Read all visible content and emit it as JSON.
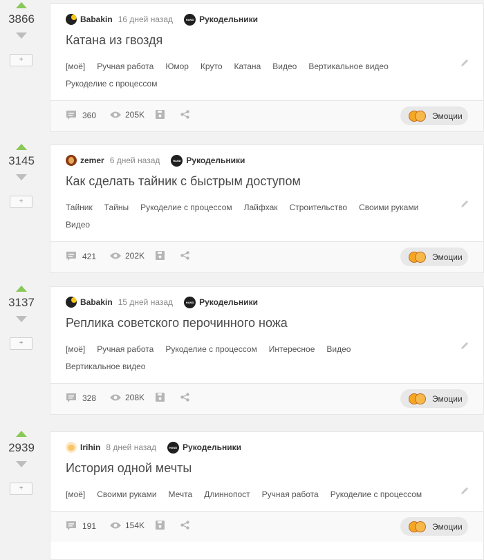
{
  "posts": [
    {
      "score": "3866",
      "plus_label": "+",
      "author": "Babakin",
      "time": "16 дней назад",
      "community": "Рукодельники",
      "community_logo_text": "HAND MADE",
      "title": "Катана из гвоздя",
      "tags": [
        "[моё]",
        "Ручная работа",
        "Юмор",
        "Круто",
        "Катана",
        "Видео",
        "Вертикальное видео",
        "Рукоделие с процессом"
      ],
      "comments": "360",
      "views": "205K",
      "emotions_label": "Эмоции"
    },
    {
      "score": "3145",
      "plus_label": "+",
      "author": "zemer",
      "time": "6 дней назад",
      "community": "Рукодельники",
      "community_logo_text": "HAND MADE",
      "title": "Как сделать тайник с быстрым доступом",
      "tags": [
        "Тайник",
        "Тайны",
        "Рукоделие с процессом",
        "Лайфхак",
        "Строительство",
        "Своими руками",
        "Видео"
      ],
      "comments": "421",
      "views": "202K",
      "emotions_label": "Эмоции"
    },
    {
      "score": "3137",
      "plus_label": "+",
      "author": "Babakin",
      "time": "15 дней назад",
      "community": "Рукодельники",
      "community_logo_text": "HAND MADE",
      "title": "Реплика советского перочинного ножа",
      "tags": [
        "[моё]",
        "Ручная работа",
        "Рукоделие с процессом",
        "Интересное",
        "Видео",
        "Вертикальное видео"
      ],
      "comments": "328",
      "views": "208K",
      "emotions_label": "Эмоции"
    },
    {
      "score": "2939",
      "plus_label": "+",
      "author": "Irihin",
      "time": "8 дней назад",
      "community": "Рукодельники",
      "community_logo_text": "HAND MADE",
      "title": "История одной мечты",
      "tags": [
        "[моё]",
        "Своими руками",
        "Мечта",
        "Длиннопост",
        "Ручная работа",
        "Рукоделие с процессом"
      ],
      "comments": "191",
      "views": "154K",
      "emotions_label": "Эмоции"
    }
  ],
  "icons": {
    "upvote": "triangle-up-green",
    "downvote": "triangle-down-grey",
    "comments": "speech-bubble-icon",
    "views": "eye-icon",
    "save": "floppy-disk-icon",
    "share": "share-icon",
    "edit": "pencil-icon"
  },
  "colors": {
    "upvote": "#8ac858",
    "downvote": "#bdbdbd",
    "background": "#f2f2f2",
    "card": "#ffffff",
    "footer": "#f9f9f9"
  }
}
